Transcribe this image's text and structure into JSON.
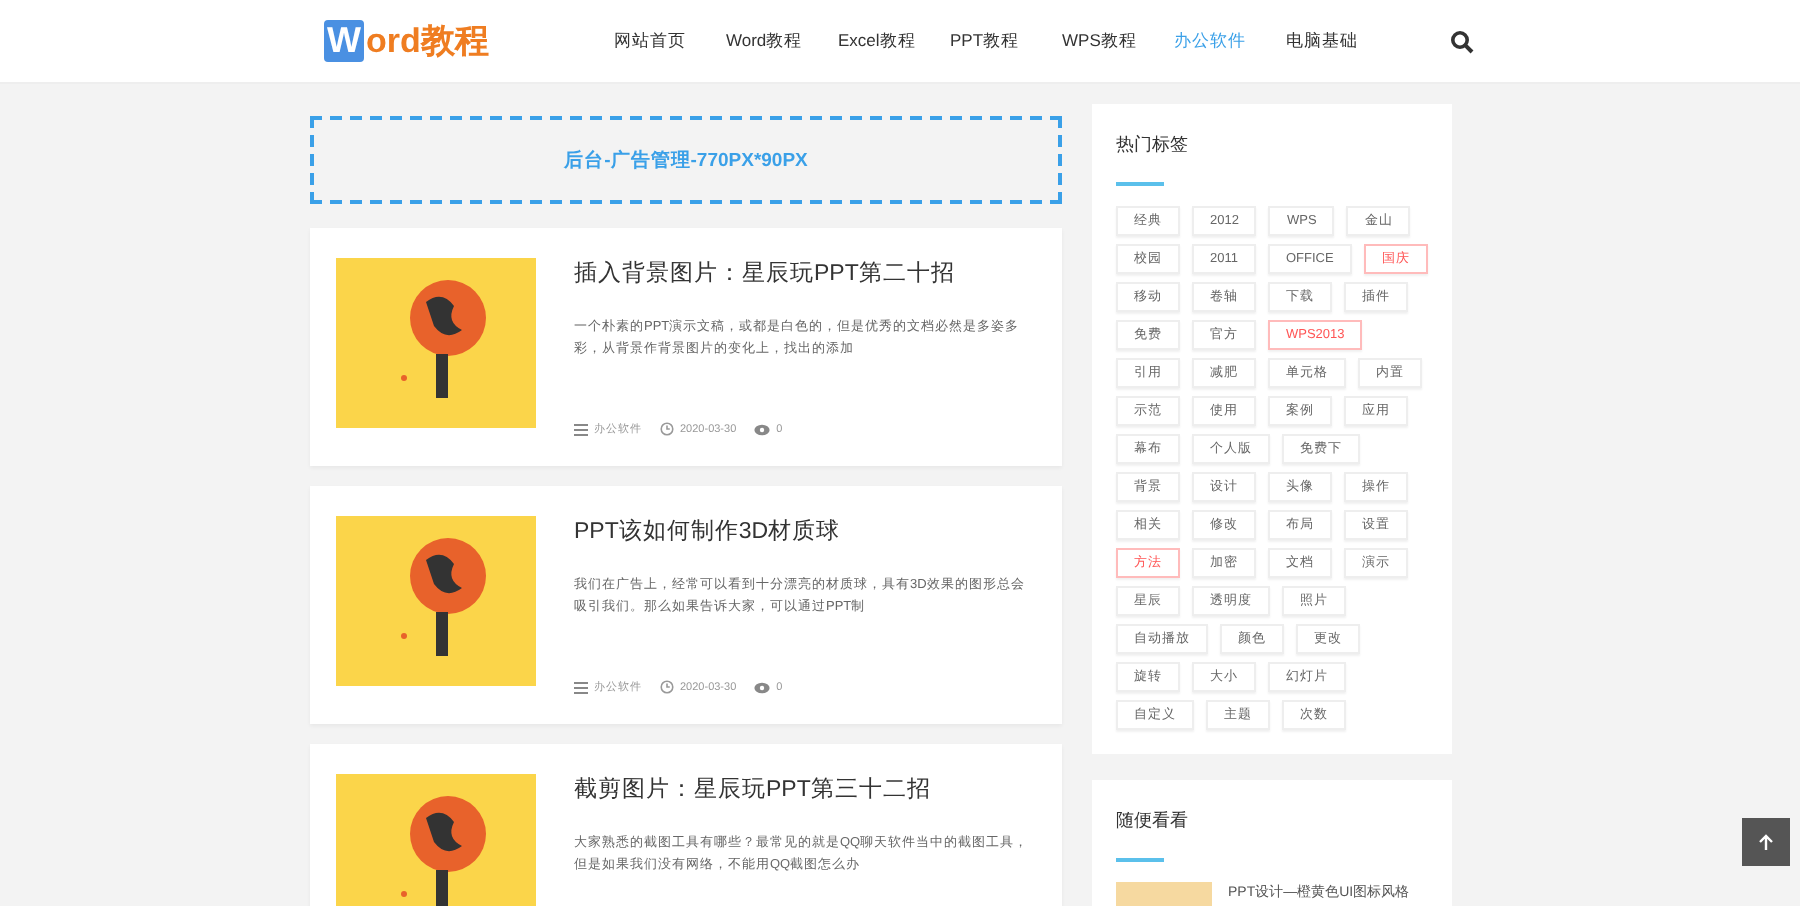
{
  "header": {
    "logo": {
      "badge": "W",
      "text": "ord教程"
    },
    "nav": [
      {
        "label": "网站首页",
        "selected": false
      },
      {
        "label": "Word教程",
        "selected": false
      },
      {
        "label": "Excel教程",
        "selected": false
      },
      {
        "label": "PPT教程",
        "selected": false
      },
      {
        "label": "WPS教程",
        "selected": false
      },
      {
        "label": "办公软件",
        "selected": true
      },
      {
        "label": "电脑基础",
        "selected": false
      }
    ]
  },
  "ad_banner": "后台-广告管理-770PX*90PX",
  "articles": [
    {
      "title": "插入背景图片：星辰玩PPT第二十招",
      "excerpt": "一个朴素的PPT演示文稿，或都是白色的，但是优秀的文档必然是多姿多彩，从背景作背景图片的变化上，找出的添加",
      "category": "办公软件",
      "date": "2020-03-30",
      "views": "0"
    },
    {
      "title": "PPT该如何制作3D材质球",
      "excerpt": "我们在广告上，经常可以看到十分漂亮的材质球，具有3D效果的图形总会吸引我们。那么如果告诉大家，可以通过PPT制",
      "category": "办公软件",
      "date": "2020-03-30",
      "views": "0"
    },
    {
      "title": "截剪图片：星辰玩PPT第三十二招",
      "excerpt": "大家熟悉的截图工具有哪些？最常见的就是QQ聊天软件当中的截图工具，但是如果我们没有网络，不能用QQ截图怎么办"
    }
  ],
  "hot_tags": {
    "title": "热门标签",
    "tags": [
      {
        "label": "经典",
        "highlighted": false
      },
      {
        "label": "2012",
        "highlighted": false
      },
      {
        "label": "WPS",
        "highlighted": false
      },
      {
        "label": "金山",
        "highlighted": false
      },
      {
        "label": "校园",
        "highlighted": false
      },
      {
        "label": "2011",
        "highlighted": false
      },
      {
        "label": "OFFICE",
        "highlighted": false
      },
      {
        "label": "国庆",
        "highlighted": true
      },
      {
        "label": "移动",
        "highlighted": false
      },
      {
        "label": "卷轴",
        "highlighted": false
      },
      {
        "label": "下载",
        "highlighted": false
      },
      {
        "label": "插件",
        "highlighted": false
      },
      {
        "label": "免费",
        "highlighted": false
      },
      {
        "label": "官方",
        "highlighted": false
      },
      {
        "label": "WPS2013",
        "highlighted": true
      },
      {
        "label": "引用",
        "highlighted": false
      },
      {
        "label": "减肥",
        "highlighted": false
      },
      {
        "label": "单元格",
        "highlighted": false
      },
      {
        "label": "内置",
        "highlighted": false
      },
      {
        "label": "示范",
        "highlighted": false
      },
      {
        "label": "使用",
        "highlighted": false
      },
      {
        "label": "案例",
        "highlighted": false
      },
      {
        "label": "应用",
        "highlighted": false
      },
      {
        "label": "幕布",
        "highlighted": false
      },
      {
        "label": "个人版",
        "highlighted": false
      },
      {
        "label": "免费下",
        "highlighted": false
      },
      {
        "label": "背景",
        "highlighted": false
      },
      {
        "label": "设计",
        "highlighted": false
      },
      {
        "label": "头像",
        "highlighted": false
      },
      {
        "label": "操作",
        "highlighted": false
      },
      {
        "label": "相关",
        "highlighted": false
      },
      {
        "label": "修改",
        "highlighted": false
      },
      {
        "label": "布局",
        "highlighted": false
      },
      {
        "label": "设置",
        "highlighted": false
      },
      {
        "label": "方法",
        "highlighted": true
      },
      {
        "label": "加密",
        "highlighted": false
      },
      {
        "label": "文档",
        "highlighted": false
      },
      {
        "label": "演示",
        "highlighted": false
      },
      {
        "label": "星辰",
        "highlighted": false
      },
      {
        "label": "透明度",
        "highlighted": false
      },
      {
        "label": "照片",
        "highlighted": false
      },
      {
        "label": "自动播放",
        "highlighted": false
      },
      {
        "label": "颜色",
        "highlighted": false
      },
      {
        "label": "更改",
        "highlighted": false
      },
      {
        "label": "旋转",
        "highlighted": false
      },
      {
        "label": "大小",
        "highlighted": false
      },
      {
        "label": "幻灯片",
        "highlighted": false
      },
      {
        "label": "自定义",
        "highlighted": false
      },
      {
        "label": "主题",
        "highlighted": false
      },
      {
        "label": "次数",
        "highlighted": false
      }
    ]
  },
  "random": {
    "title": "随便看看",
    "items": [
      {
        "title": "PPT设计—橙黄色UI图标风格"
      }
    ]
  }
}
